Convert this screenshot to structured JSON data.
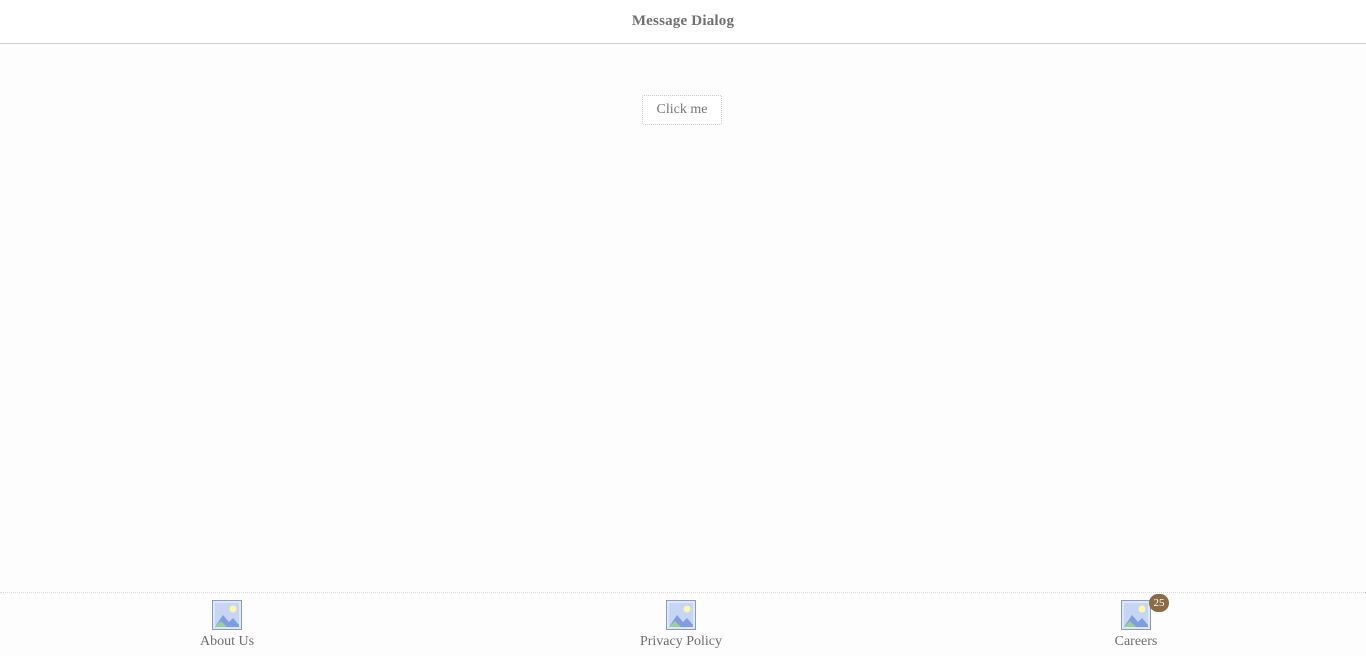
{
  "header": {
    "title": "Message Dialog"
  },
  "main": {
    "button_label": "Click me"
  },
  "tabbar": {
    "items": [
      {
        "label": "About Us",
        "icon": "image-placeholder-icon"
      },
      {
        "label": "Privacy Policy",
        "icon": "image-placeholder-icon"
      },
      {
        "label": "Careers",
        "icon": "image-placeholder-icon",
        "badge": "25"
      }
    ]
  },
  "colors": {
    "badge": "#8b6b45",
    "header_border": "#c8ccd8",
    "text": "#707070"
  }
}
